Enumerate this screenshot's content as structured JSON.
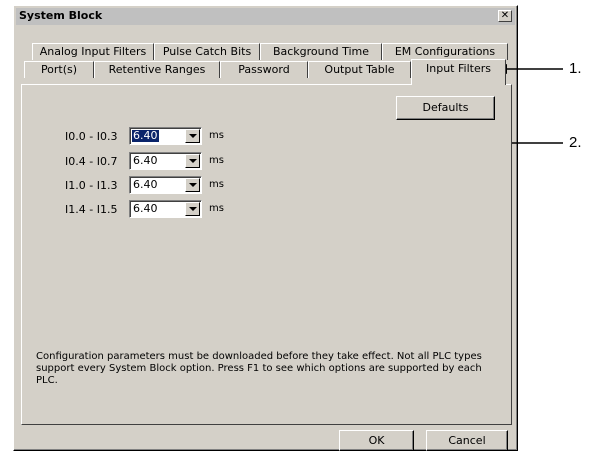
{
  "window": {
    "title": "System Block",
    "close_symbol": "✕"
  },
  "tabs_back": [
    {
      "label": "Analog Input Filters"
    },
    {
      "label": "Pulse Catch Bits"
    },
    {
      "label": "Background Time"
    },
    {
      "label": "EM Configurations"
    }
  ],
  "tabs_front": [
    {
      "label": "Port(s)"
    },
    {
      "label": "Retentive Ranges"
    },
    {
      "label": "Password"
    },
    {
      "label": "Output Table"
    },
    {
      "label": "Input Filters"
    }
  ],
  "active_tab": "Input Filters",
  "defaults_button": "Defaults",
  "filters": [
    {
      "label": "I0.0 - I0.3",
      "value": "6.40",
      "unit": "ms"
    },
    {
      "label": "I0.4 - I0.7",
      "value": "6.40",
      "unit": "ms"
    },
    {
      "label": "I1.0 - I1.3",
      "value": "6.40",
      "unit": "ms"
    },
    {
      "label": "I1.4 - I1.5",
      "value": "6.40",
      "unit": "ms"
    }
  ],
  "info_text": "Configuration parameters must be downloaded before they take effect. Not all PLC types support every System Block option.  Press F1 to see which options are supported by each PLC.",
  "ok_button": "OK",
  "cancel_button": "Cancel",
  "callouts": {
    "one": "1.",
    "two": "2."
  }
}
